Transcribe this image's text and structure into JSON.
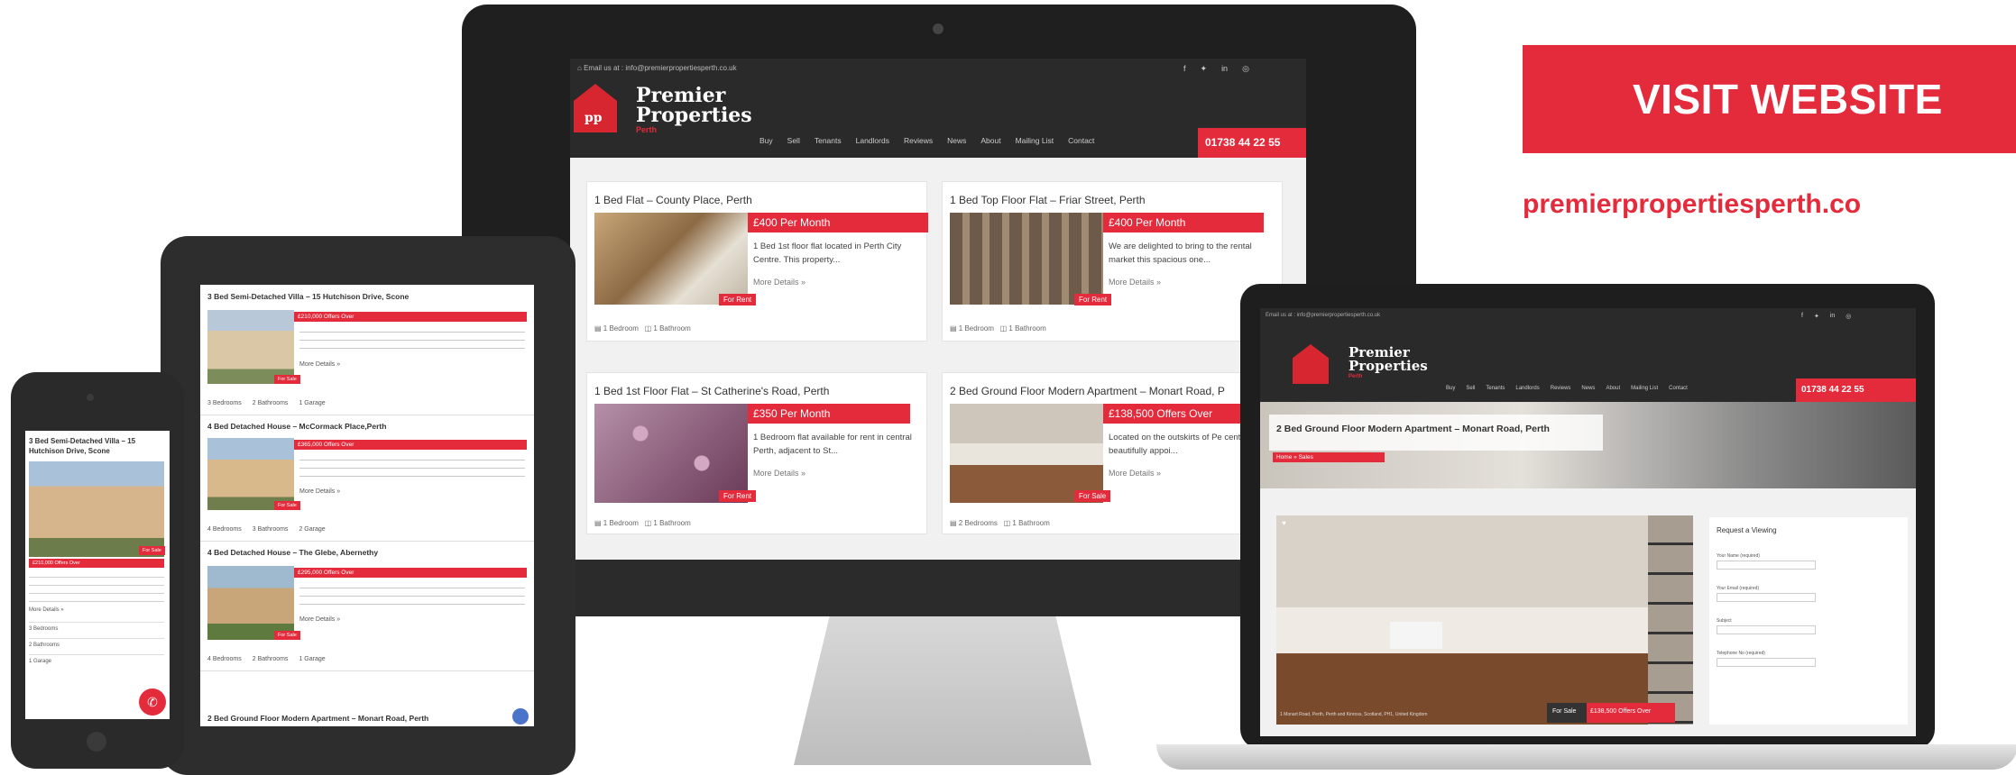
{
  "cta": {
    "button_label": "VISIT WEBSITE",
    "url": "premierpropertiesperth.co"
  },
  "site": {
    "email": "Email us at : info@premierpropertiesperth.co.uk",
    "logo_line1": "Premier",
    "logo_line2": "Properties",
    "logo_line3": "Perth",
    "nav": [
      "Buy",
      "Sell",
      "Tenants",
      "Landlords",
      "Reviews",
      "News",
      "About",
      "Mailing List",
      "Contact"
    ],
    "phone": "01738 44 22 55",
    "social": [
      "f",
      "✦",
      "in",
      "◎"
    ]
  },
  "desktop": {
    "cards": [
      {
        "title": "1 Bed Flat – County Place, Perth",
        "price": "£400 Per Month",
        "status": "For Rent",
        "desc": "1 Bed 1st floor flat located in Perth City Centre. This property...",
        "more": "More Details »",
        "beds": "1 Bedroom",
        "baths": "1 Bathroom"
      },
      {
        "title": "1 Bed Top Floor Flat – Friar Street, Perth",
        "price": "£400 Per Month",
        "status": "For Rent",
        "desc": "We are delighted to bring to the rental market this spacious one...",
        "more": "More Details »",
        "beds": "1 Bedroom",
        "baths": "1 Bathroom"
      },
      {
        "title": "1 Bed 1st Floor Flat – St Catherine's Road, Perth",
        "price": "£350 Per Month",
        "status": "For Rent",
        "desc": "1 Bedroom flat available for rent in central Perth, adjacent to St...",
        "more": "More Details »",
        "beds": "1 Bedroom",
        "baths": "1 Bathroom"
      },
      {
        "title": "2 Bed Ground Floor Modern Apartment – Monart Road, P",
        "price": "£138,500 Offers Over",
        "status": "For Sale",
        "desc": "Located on the outskirts of Pe centre is this beautifully appoi...",
        "more": "More Details »",
        "beds": "2 Bedrooms",
        "baths": "1 Bathroom"
      }
    ]
  },
  "tablet": {
    "items": [
      {
        "title": "3 Bed Semi-Detached Villa – 15 Hutchison Drive, Scone",
        "price": "£210,000 Offers Over",
        "status": "For Sale",
        "more": "More Details »",
        "feats": [
          "3 Bedrooms",
          "2 Bathrooms",
          "1 Garage"
        ]
      },
      {
        "title": "4 Bed Detached House – McCormack Place,Perth",
        "price": "£365,000 Offers Over",
        "status": "For Sale",
        "more": "More Details »",
        "feats": [
          "4 Bedrooms",
          "3 Bathrooms",
          "2 Garage"
        ]
      },
      {
        "title": "4 Bed Detached House – The Glebe, Abernethy",
        "price": "£295,000 Offers Over",
        "status": "For Sale",
        "more": "More Details »",
        "feats": [
          "4 Bedrooms",
          "2 Bathrooms",
          "1 Garage"
        ]
      },
      {
        "title": "2 Bed Ground Floor Modern Apartment – Monart Road, Perth"
      }
    ]
  },
  "phone_device": {
    "title": "3 Bed Semi-Detached Villa – 15 Hutchison Drive, Scone",
    "status": "For Sale",
    "price": "£210,000 Offers Over",
    "more": "More Details »",
    "feats": [
      "3 Bedrooms",
      "2 Bathrooms",
      "1 Garage"
    ]
  },
  "laptop": {
    "page_title": "2 Bed Ground Floor Modern Apartment – Monart Road, Perth",
    "breadcrumb": "Home » Sales",
    "form_title": "Request a Viewing",
    "fields": [
      "Your Name (required)",
      "Your Email (required)",
      "Subject",
      "Telephone No (required)"
    ],
    "address": "1 Monart Road, Perth, Perth and Kinross, Scotland, PH1, United Kingdom",
    "status": "For Sale",
    "price": "£138,500 Offers Over"
  },
  "colors": {
    "accent": "#e32b3c",
    "dark": "#2a2a2a"
  }
}
